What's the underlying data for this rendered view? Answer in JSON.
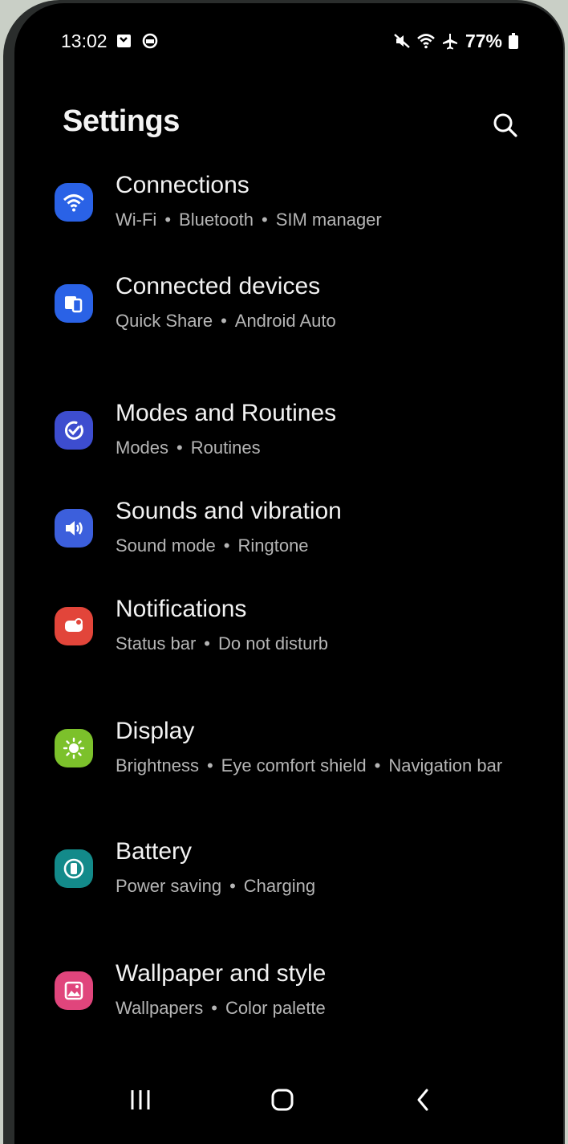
{
  "status_bar": {
    "time": "13:02",
    "battery": "77%",
    "icons": [
      "message-icon",
      "sync-icon",
      "mute-icon",
      "wifi-icon",
      "airplane-icon",
      "battery-icon"
    ]
  },
  "header": {
    "title": "Settings",
    "search_icon": "search-icon"
  },
  "items": [
    {
      "name": "Connections",
      "subs": [
        "Wi-Fi",
        "Bluetooth",
        "SIM manager"
      ],
      "icon": "wifi-icon",
      "color": "#2a62e6"
    },
    {
      "name": "Connected devices",
      "subs": [
        "Quick Share",
        "Android Auto"
      ],
      "icon": "devices-icon",
      "color": "#2a62e6"
    },
    {
      "name": "Modes and Routines",
      "subs": [
        "Modes",
        "Routines"
      ],
      "icon": "check-circle-icon",
      "color": "#3d4dcf"
    },
    {
      "name": "Sounds and vibration",
      "subs": [
        "Sound mode",
        "Ringtone"
      ],
      "icon": "speaker-icon",
      "color": "#3c5fdc"
    },
    {
      "name": "Notifications",
      "subs": [
        "Status bar",
        "Do not disturb"
      ],
      "icon": "notification-icon",
      "color": "#e2453a"
    },
    {
      "name": "Display",
      "subs": [
        "Brightness",
        "Eye comfort shield",
        "Navigation bar"
      ],
      "icon": "sun-icon",
      "color": "#7cc12b"
    },
    {
      "name": "Battery",
      "subs": [
        "Power saving",
        "Charging"
      ],
      "icon": "battery-circle-icon",
      "color": "#138a8a"
    },
    {
      "name": "Wallpaper and style",
      "subs": [
        "Wallpapers",
        "Color palette"
      ],
      "icon": "image-icon",
      "color": "#e0457c"
    }
  ],
  "nav": {
    "icons": [
      "recent-apps-icon",
      "home-icon",
      "back-icon"
    ]
  }
}
